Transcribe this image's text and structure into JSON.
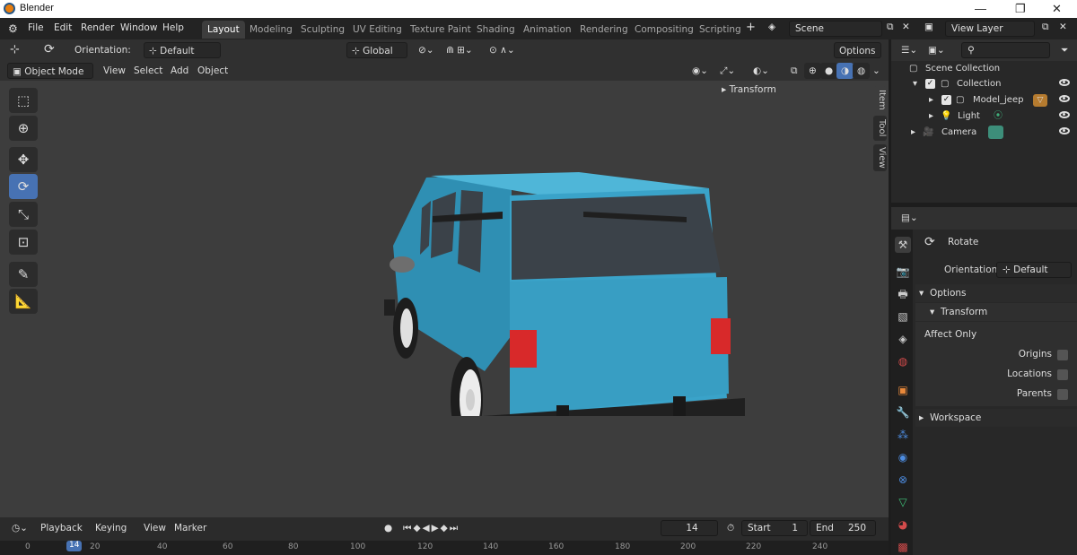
{
  "window": {
    "title": "Blender",
    "minimize": "—",
    "maximize": "❐",
    "close": "✕"
  },
  "menu": [
    "File",
    "Edit",
    "Render",
    "Window",
    "Help"
  ],
  "workspace_tabs": [
    "Layout",
    "Modeling",
    "Sculpting",
    "UV Editing",
    "Texture Paint",
    "Shading",
    "Animation",
    "Rendering",
    "Compositing",
    "Scripting"
  ],
  "active_tab": "Layout",
  "add_tab": "+",
  "scene": {
    "name": "Scene",
    "view_layer": "View Layer"
  },
  "tool_header": {
    "orientation_label": "Orientation:",
    "orientation_value": "Default",
    "options": "Options",
    "transform": "Global"
  },
  "viewport_header": {
    "mode": "Object Mode",
    "menus": [
      "View",
      "Select",
      "Add",
      "Object"
    ]
  },
  "sidebar": {
    "transform_label": "Transform",
    "tabs": [
      "Item",
      "Tool",
      "View"
    ]
  },
  "outliner": {
    "search_placeholder": "",
    "rows": [
      {
        "label": "Scene Collection"
      },
      {
        "label": "Collection"
      },
      {
        "label": "Model_jeep"
      },
      {
        "label": "Light"
      },
      {
        "label": "Camera"
      }
    ]
  },
  "properties": {
    "tool_name": "Rotate",
    "orientation_label": "Orientation",
    "orientation_value": "Default",
    "options_label": "Options",
    "transform_label": "Transform",
    "affect_only_label": "Affect Only",
    "checkboxes": [
      "Origins",
      "Locations",
      "Parents"
    ],
    "workspace_label": "Workspace"
  },
  "timeline": {
    "menus": [
      "Playback",
      "Keying",
      "View",
      "Marker"
    ],
    "current_frame": "14",
    "start_label": "Start",
    "start_value": "1",
    "end_label": "End",
    "end_value": "250",
    "ruler": [
      "0",
      "14",
      "20",
      "40",
      "60",
      "80",
      "100",
      "120",
      "140",
      "160",
      "180",
      "200",
      "220",
      "240"
    ]
  },
  "colors": {
    "accent": "#4772b3",
    "jeep_body": "#3a9fc4",
    "taillight": "#d8292a"
  }
}
